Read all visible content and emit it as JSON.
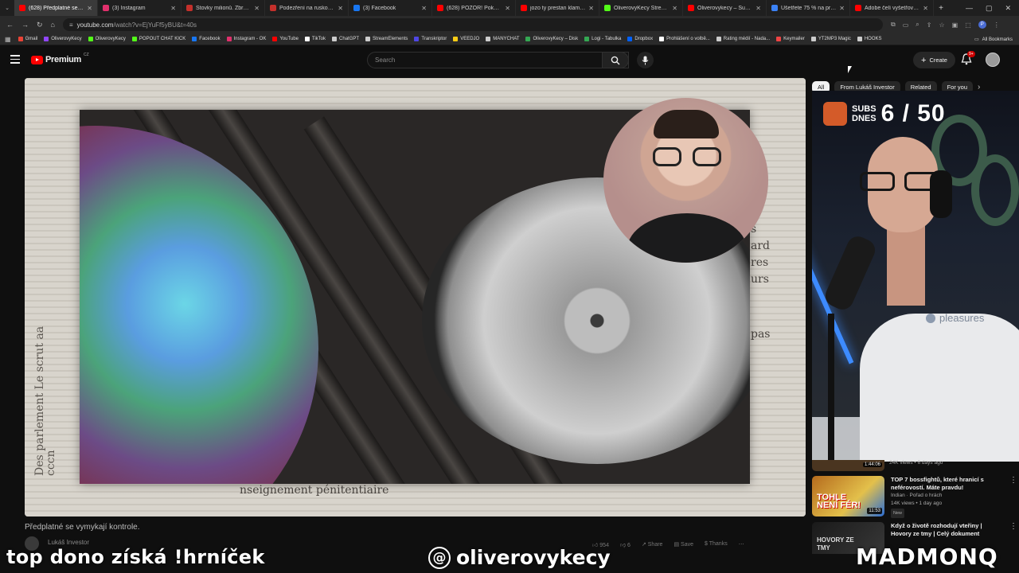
{
  "browser": {
    "tabs": [
      {
        "title": "(628) Předplatné se vy",
        "active": true,
        "color": "#ff0000"
      },
      {
        "title": "(3) Instagram",
        "active": false,
        "color": "#e1306c"
      },
      {
        "title": "Stovky milionů. Zbrojovk",
        "active": false,
        "color": "#c4302b"
      },
      {
        "title": "Podezření na ruskou stop",
        "active": false,
        "color": "#c4302b"
      },
      {
        "title": "(3) Facebook",
        "active": false,
        "color": "#1877f2"
      },
      {
        "title": "(628) POZOR! Pokusili se",
        "active": false,
        "color": "#ff0000"
      },
      {
        "title": "jozo ty prestan klamat d",
        "active": false,
        "color": "#ff0000"
      },
      {
        "title": "OliverovyKecy Stream - V",
        "active": false,
        "color": "#53fc18"
      },
      {
        "title": "Oliverovykecy – Support",
        "active": false,
        "color": "#ff0000"
      },
      {
        "title": "Ušetřete 75 % na produk",
        "active": false,
        "color": "#3b82f6"
      },
      {
        "title": "Adobe čelí vyšetřování",
        "active": false,
        "color": "#ff0000"
      }
    ],
    "new_tab": "+",
    "url": {
      "domain": "youtube.com",
      "path": "/watch?v=EjYuFf5yBU&t=40s"
    },
    "profile_letter": "P",
    "bookmarks": [
      {
        "label": "Gmail",
        "color": "#ea4335"
      },
      {
        "label": "OliverovyKecy",
        "color": "#9146ff"
      },
      {
        "label": "OliverovyKecy",
        "color": "#53fc18"
      },
      {
        "label": "POPOUT CHAT KICK",
        "color": "#53fc18"
      },
      {
        "label": "Facebook",
        "color": "#1877f2"
      },
      {
        "label": "Instagram - OK",
        "color": "#e1306c"
      },
      {
        "label": "YouTube",
        "color": "#ff0000"
      },
      {
        "label": "TikTok",
        "color": "#ffffff"
      },
      {
        "label": "ChatGPT",
        "color": "#cccccc"
      },
      {
        "label": "StreamElements",
        "color": "#cccccc"
      },
      {
        "label": "Transkriptor",
        "color": "#4f46e5"
      },
      {
        "label": "VEEDJO",
        "color": "#facc15"
      },
      {
        "label": "MANYCHAT",
        "color": "#cccccc"
      },
      {
        "label": "OliverovyKecy – Disk",
        "color": "#34a853"
      },
      {
        "label": "Logi - Tabulka",
        "color": "#34a853"
      },
      {
        "label": "Dropbox",
        "color": "#0061ff"
      },
      {
        "label": "Prohlášení o volbě...",
        "color": "#ffffff"
      },
      {
        "label": "Rating médií - Nada...",
        "color": "#cccccc"
      },
      {
        "label": "Keymailer",
        "color": "#ef4444"
      },
      {
        "label": "YT2MP3 Magic",
        "color": "#cccccc"
      },
      {
        "label": "HOOKS",
        "color": "#cccccc"
      }
    ],
    "all_bookmarks": "All Bookmarks"
  },
  "youtube": {
    "logo": "Premium",
    "region": "CZ",
    "search_placeholder": "Search",
    "create_label": "Create",
    "notif_badge": "9+",
    "chips": [
      "All",
      "From Lukáš Investor",
      "Related",
      "For you"
    ],
    "video_title": "Předplatné se vymykají kontrole.",
    "channel": "Lukáš Investor",
    "actions": [
      {
        "label": "954",
        "icon": "like-icon"
      },
      {
        "label": "6",
        "icon": "dislike-icon"
      },
      {
        "label": "Share",
        "icon": "share-icon"
      },
      {
        "label": "Save",
        "icon": "save-icon"
      },
      {
        "label": "Thanks",
        "icon": "thanks-icon"
      }
    ],
    "video_text": {
      "left": "Des parlement Le scrut aa cccn",
      "bottom": "nseignement pénitentiaire",
      "right": [
        "s",
        "ard",
        "res",
        "urs",
        "pas"
      ]
    },
    "partial_rec": {
      "duration": "1:44:06",
      "meta": "24K views • 6 days ago"
    },
    "recommendations": [
      {
        "title": "TOP 7 bossfightů, které hranicí s neférovostí. Máte pravdu!",
        "channel": "Indian · Pořad o hrách",
        "stats": "14K views • 1 day ago",
        "badge": "New",
        "duration": "11:53",
        "thumb_text": "TOHLE NENÍ FÉR!"
      },
      {
        "title": "Když o životě rozhodují vteřiny | Hovory ze tmy | Celý dokument",
        "channel": "",
        "stats": "",
        "badge": "",
        "duration": "",
        "thumb_text": "HOVORY ZE TMY"
      }
    ]
  },
  "stream_overlay": {
    "subs_label_1": "SUBS",
    "subs_label_2": "DNES",
    "subs_count": "6 / 50",
    "shirt_brand": "pleasures",
    "bottom_left": "top dono získá !hrníček",
    "bottom_mid": "oliverovykecy",
    "bottom_right": "MADMONQ"
  }
}
